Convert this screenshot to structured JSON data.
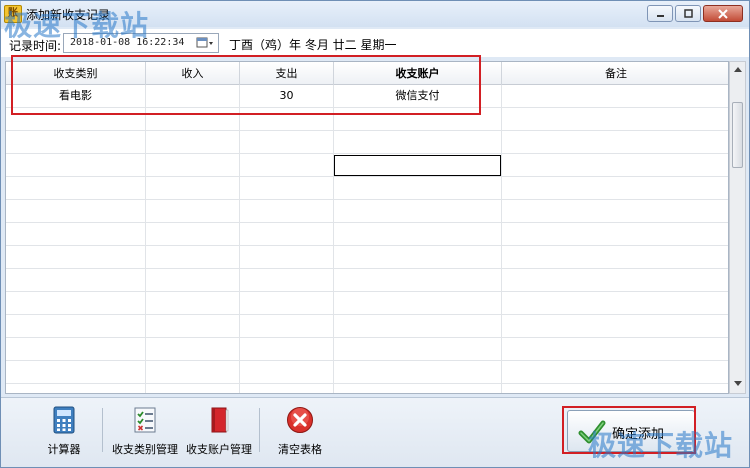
{
  "window": {
    "title": "添加新收支记录",
    "app_icon_glyph": "账"
  },
  "timebar": {
    "label": "记录时间:",
    "datetime": "2018-01-08 16:22:34",
    "lunar_date": "丁酉（鸡）年 冬月 廿二 星期一"
  },
  "grid": {
    "columns": [
      "收支类别",
      "收入",
      "支出",
      "收支账户",
      "备注"
    ],
    "rows": [
      [
        "看电影",
        "",
        "30",
        "微信支付",
        ""
      ]
    ]
  },
  "toolbar": {
    "calculator_label": "计算器",
    "category_label": "收支类别管理",
    "account_label": "收支账户管理",
    "clear_label": "清空表格",
    "confirm_label": "确定添加"
  },
  "watermark": {
    "text": "极速下载站"
  },
  "colors": {
    "highlight": "#d21f24",
    "watermark": "#2878c8"
  }
}
